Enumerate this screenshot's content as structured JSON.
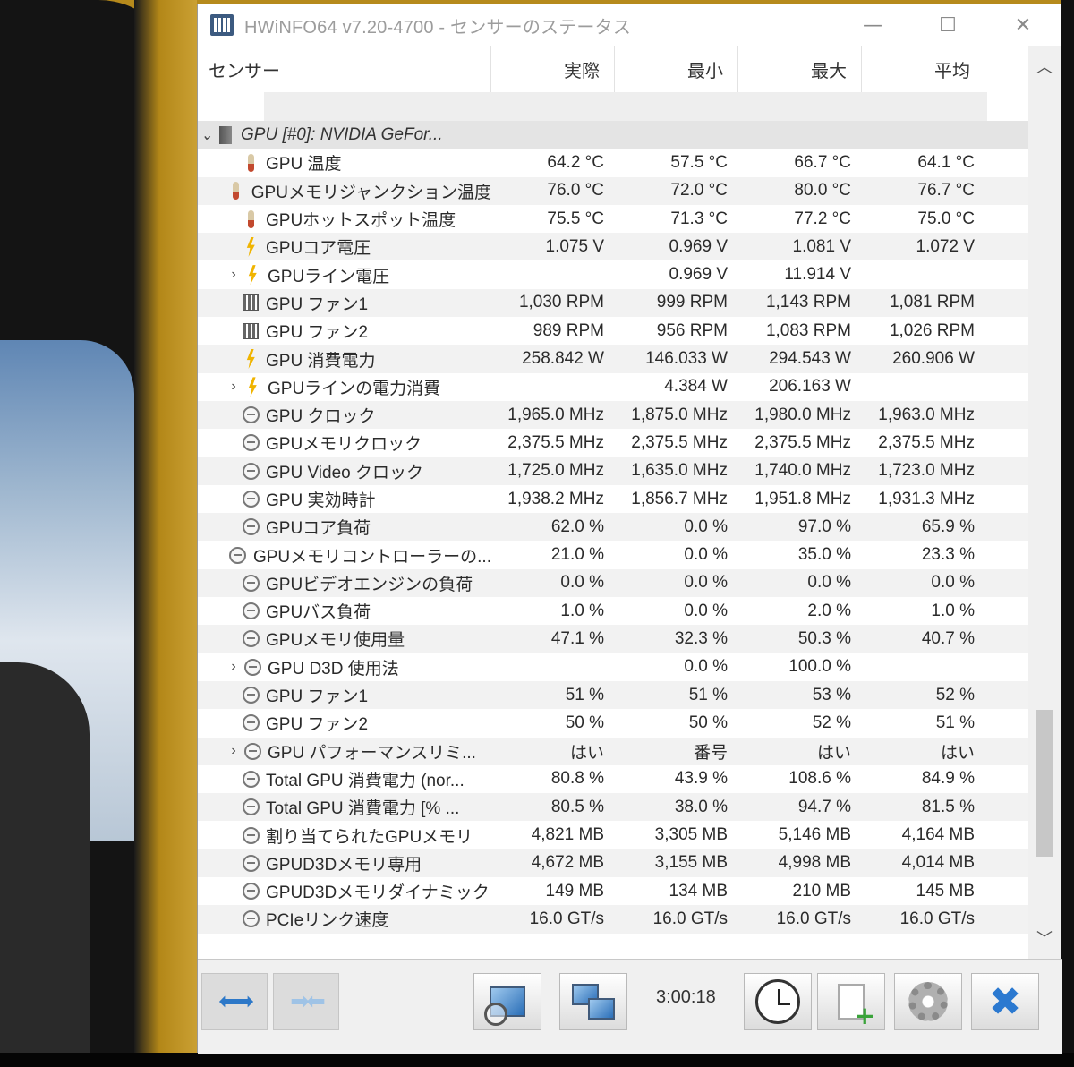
{
  "window": {
    "title": "HWiNFO64 v7.20-4700 - センサーのステータス",
    "minimize": "—",
    "maximize": "☐",
    "close": "✕"
  },
  "columns": {
    "sensor": "センサー",
    "current": "実際",
    "min": "最小",
    "max": "最大",
    "avg": "平均"
  },
  "group": {
    "label": "GPU [#0]: NVIDIA GeFor..."
  },
  "rows": [
    {
      "name": "GPU 温度",
      "icon": "thermometer-icon",
      "cur": "64.2 °C",
      "min": "57.5 °C",
      "max": "66.7 °C",
      "avg": "64.1 °C"
    },
    {
      "name": "GPUメモリジャンクション温度",
      "icon": "thermometer-icon",
      "cur": "76.0 °C",
      "min": "72.0 °C",
      "max": "80.0 °C",
      "avg": "76.7 °C"
    },
    {
      "name": "GPUホットスポット温度",
      "icon": "thermometer-icon",
      "cur": "75.5 °C",
      "min": "71.3 °C",
      "max": "77.2 °C",
      "avg": "75.0 °C"
    },
    {
      "name": "GPUコア電圧",
      "icon": "bolt-icon",
      "cur": "1.075 V",
      "min": "0.969 V",
      "max": "1.081 V",
      "avg": "1.072 V"
    },
    {
      "name": "GPUライン電圧",
      "icon": "bolt-icon",
      "expand": true,
      "cur": "",
      "min": "0.969 V",
      "max": "11.914 V",
      "avg": ""
    },
    {
      "name": "GPU ファン1",
      "icon": "fan-icon",
      "cur": "1,030 RPM",
      "min": "999 RPM",
      "max": "1,143 RPM",
      "avg": "1,081 RPM"
    },
    {
      "name": "GPU ファン2",
      "icon": "fan-icon",
      "cur": "989 RPM",
      "min": "956 RPM",
      "max": "1,083 RPM",
      "avg": "1,026 RPM"
    },
    {
      "name": "GPU 消費電力",
      "icon": "bolt-icon",
      "cur": "258.842 W",
      "min": "146.033 W",
      "max": "294.543 W",
      "avg": "260.906 W"
    },
    {
      "name": "GPUラインの電力消費",
      "icon": "bolt-icon",
      "expand": true,
      "cur": "",
      "min": "4.384 W",
      "max": "206.163 W",
      "avg": ""
    },
    {
      "name": "GPU クロック",
      "icon": "clock-icon",
      "cur": "1,965.0 MHz",
      "min": "1,875.0 MHz",
      "max": "1,980.0 MHz",
      "avg": "1,963.0 MHz"
    },
    {
      "name": "GPUメモリクロック",
      "icon": "clock-icon",
      "cur": "2,375.5 MHz",
      "min": "2,375.5 MHz",
      "max": "2,375.5 MHz",
      "avg": "2,375.5 MHz"
    },
    {
      "name": "GPU Video クロック",
      "icon": "clock-icon",
      "cur": "1,725.0 MHz",
      "min": "1,635.0 MHz",
      "max": "1,740.0 MHz",
      "avg": "1,723.0 MHz"
    },
    {
      "name": "GPU 実効時計",
      "icon": "clock-icon",
      "cur": "1,938.2 MHz",
      "min": "1,856.7 MHz",
      "max": "1,951.8 MHz",
      "avg": "1,931.3 MHz"
    },
    {
      "name": "GPUコア負荷",
      "icon": "clock-icon",
      "cur": "62.0 %",
      "min": "0.0 %",
      "max": "97.0 %",
      "avg": "65.9 %"
    },
    {
      "name": "GPUメモリコントローラーの...",
      "icon": "clock-icon",
      "cur": "21.0 %",
      "min": "0.0 %",
      "max": "35.0 %",
      "avg": "23.3 %"
    },
    {
      "name": "GPUビデオエンジンの負荷",
      "icon": "clock-icon",
      "cur": "0.0 %",
      "min": "0.0 %",
      "max": "0.0 %",
      "avg": "0.0 %"
    },
    {
      "name": "GPUバス負荷",
      "icon": "clock-icon",
      "cur": "1.0 %",
      "min": "0.0 %",
      "max": "2.0 %",
      "avg": "1.0 %"
    },
    {
      "name": "GPUメモリ使用量",
      "icon": "clock-icon",
      "cur": "47.1 %",
      "min": "32.3 %",
      "max": "50.3 %",
      "avg": "40.7 %"
    },
    {
      "name": "GPU D3D 使用法",
      "icon": "clock-icon",
      "expand": true,
      "cur": "",
      "min": "0.0 %",
      "max": "100.0 %",
      "avg": ""
    },
    {
      "name": "GPU ファン1",
      "icon": "clock-icon",
      "cur": "51 %",
      "min": "51 %",
      "max": "53 %",
      "avg": "52 %"
    },
    {
      "name": "GPU ファン2",
      "icon": "clock-icon",
      "cur": "50 %",
      "min": "50 %",
      "max": "52 %",
      "avg": "51 %"
    },
    {
      "name": "GPU パフォーマンスリミ...",
      "icon": "clock-icon",
      "expand": true,
      "cur": "はい",
      "min": "番号",
      "max": "はい",
      "avg": "はい"
    },
    {
      "name": "Total GPU 消費電力 (nor...",
      "icon": "clock-icon",
      "cur": "80.8 %",
      "min": "43.9 %",
      "max": "108.6 %",
      "avg": "84.9 %"
    },
    {
      "name": "Total GPU 消費電力 [% ...",
      "icon": "clock-icon",
      "cur": "80.5 %",
      "min": "38.0 %",
      "max": "94.7 %",
      "avg": "81.5 %"
    },
    {
      "name": "割り当てられたGPUメモリ",
      "icon": "clock-icon",
      "cur": "4,821 MB",
      "min": "3,305 MB",
      "max": "5,146 MB",
      "avg": "4,164 MB"
    },
    {
      "name": "GPUD3Dメモリ専用",
      "icon": "clock-icon",
      "cur": "4,672 MB",
      "min": "3,155 MB",
      "max": "4,998 MB",
      "avg": "4,014 MB"
    },
    {
      "name": "GPUD3Dメモリダイナミック",
      "icon": "clock-icon",
      "cur": "149 MB",
      "min": "134 MB",
      "max": "210 MB",
      "avg": "145 MB"
    },
    {
      "name": "PCIeリンク速度",
      "icon": "clock-icon",
      "cur": "16.0 GT/s",
      "min": "16.0 GT/s",
      "max": "16.0 GT/s",
      "avg": "16.0 GT/s"
    }
  ],
  "toolbar": {
    "timer": "3:00:18",
    "nav_left_icon": "arrows-left-right-icon",
    "nav_right_icon": "arrows-collapse-icon",
    "buttons": [
      "monitor-search-icon",
      "network-icon",
      "clock-icon",
      "report-add-icon",
      "settings-gear-icon",
      "close-x-icon"
    ]
  },
  "colors": {
    "accent": "#2b79d0",
    "header_bg": "#ffffff",
    "row_alt": "#f2f2f2",
    "group_bg": "#e4e4e4"
  }
}
